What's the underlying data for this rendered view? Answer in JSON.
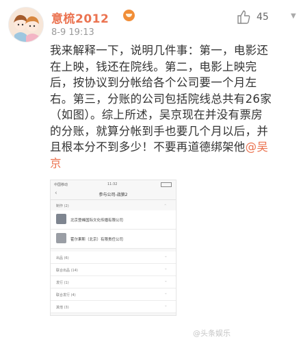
{
  "post": {
    "username": "意梳2012",
    "timestamp": "8-9 19:13",
    "like_count": "45",
    "body_lines": [
      "我来解释一下，说明几件事：第一，电影还",
      "在上映，钱还在院线。第二，电影上映完",
      "后，按协议到分帐给各个公司要一个月左",
      "右。第三，分账的公司包括院线总共有26家",
      "（如图）。综上所述，吴京现在并没有票房",
      "的分账，就算分帐到手也要几个月以后，并",
      "且根本分不到多少！不要再道德绑架他"
    ],
    "mention_part1": "@吴",
    "mention_part2": "京"
  },
  "screenshot": {
    "status_carrier": "中国移动",
    "status_time": "11:32",
    "nav_back": "‹",
    "nav_title": "参与公司-战狼2",
    "section_label": "制作 (2)",
    "companies": [
      {
        "name": "北京登峰国际文化传播有限公司"
      },
      {
        "name": "霍尔果斯（北京）有限责任公司"
      }
    ],
    "rows": [
      {
        "label": "出品 (6)"
      },
      {
        "label": "联合出品 (14)"
      },
      {
        "label": "发行 (1)"
      },
      {
        "label": "联合发行 (4)"
      },
      {
        "label": "其他 (3)"
      }
    ]
  },
  "watermark": "@头条娱乐"
}
